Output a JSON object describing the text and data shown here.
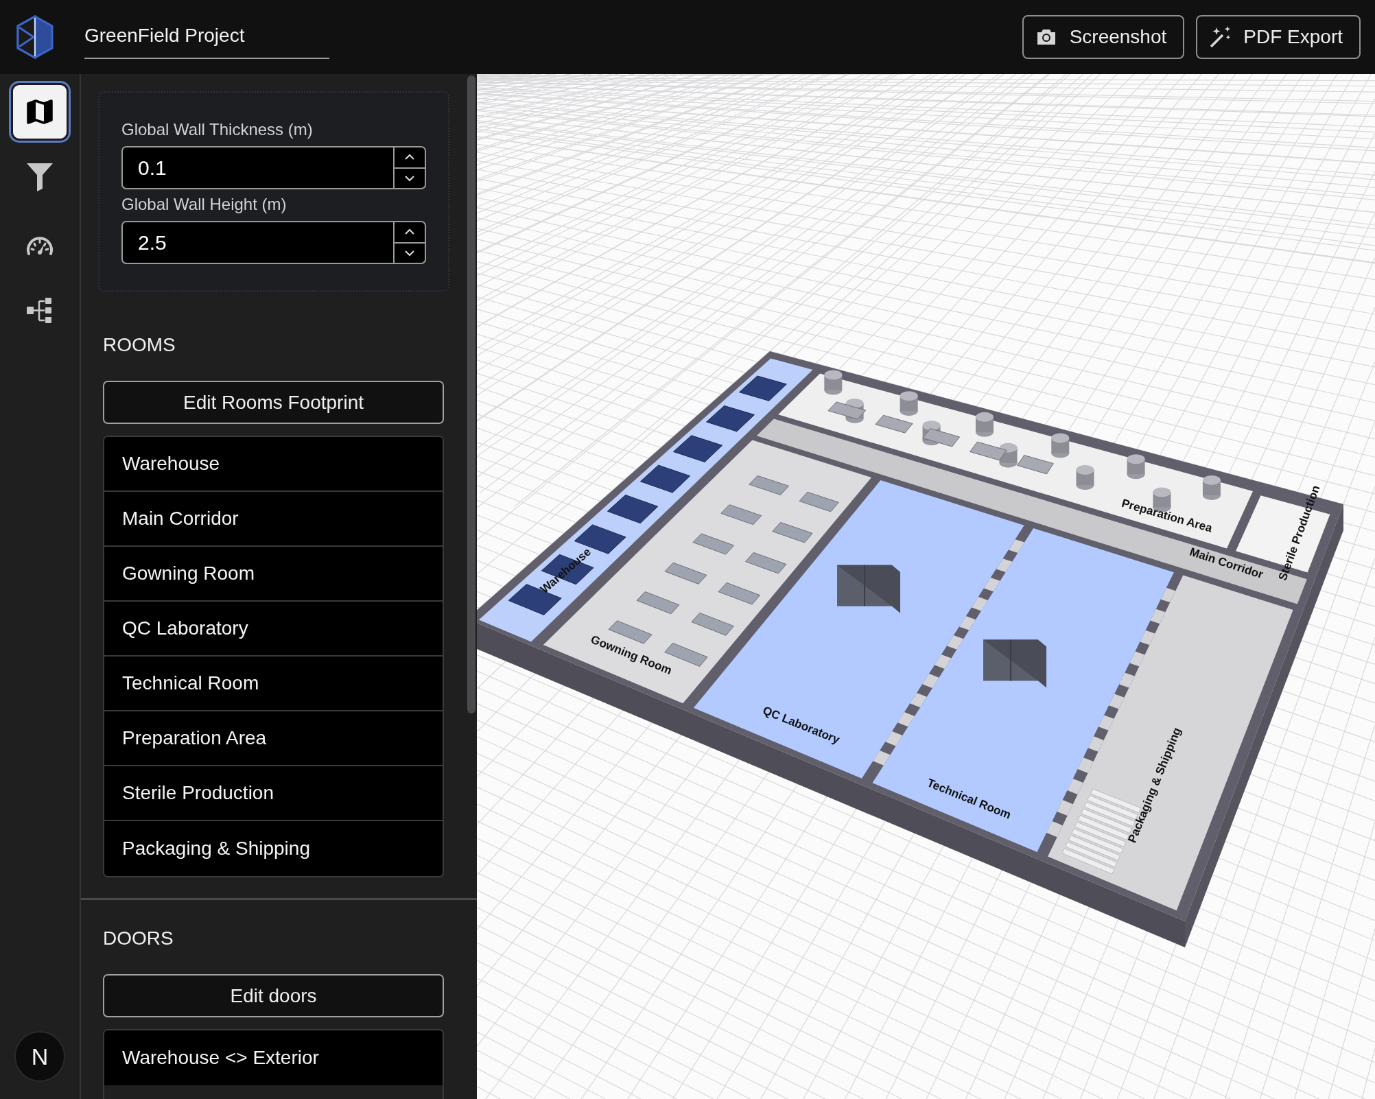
{
  "header": {
    "project_name": "GreenField Project",
    "buttons": [
      {
        "kind": "camera",
        "label": "Screenshot"
      },
      {
        "kind": "wand",
        "label": "PDF Export"
      }
    ]
  },
  "rail": {
    "items": [
      {
        "kind": "map",
        "selected": true
      },
      {
        "kind": "funnel",
        "selected": false
      },
      {
        "kind": "gauge",
        "selected": false
      },
      {
        "kind": "tree",
        "selected": false
      }
    ],
    "badge": "N"
  },
  "settings": {
    "fields": [
      {
        "label": "Global Wall Thickness (m)",
        "value": "0.1"
      },
      {
        "label": "Global Wall Height (m)",
        "value": "2.5"
      }
    ]
  },
  "rooms": {
    "heading": "ROOMS",
    "edit_button": "Edit Rooms Footprint",
    "items": [
      "Warehouse",
      "Main Corridor",
      "Gowning Room",
      "QC Laboratory",
      "Technical Room",
      "Preparation Area",
      "Sterile Production",
      "Packaging & Shipping"
    ]
  },
  "doors": {
    "heading": "DOORS",
    "edit_button": "Edit doors",
    "items": [
      "Warehouse <> Exterior"
    ]
  },
  "viewport": {
    "room_labels": [
      "Warehouse",
      "Main Corridor",
      "Gowning Room",
      "QC Laboratory",
      "Technical Room",
      "Preparation Area",
      "Sterile Production",
      "Packaging & Shipping"
    ]
  }
}
